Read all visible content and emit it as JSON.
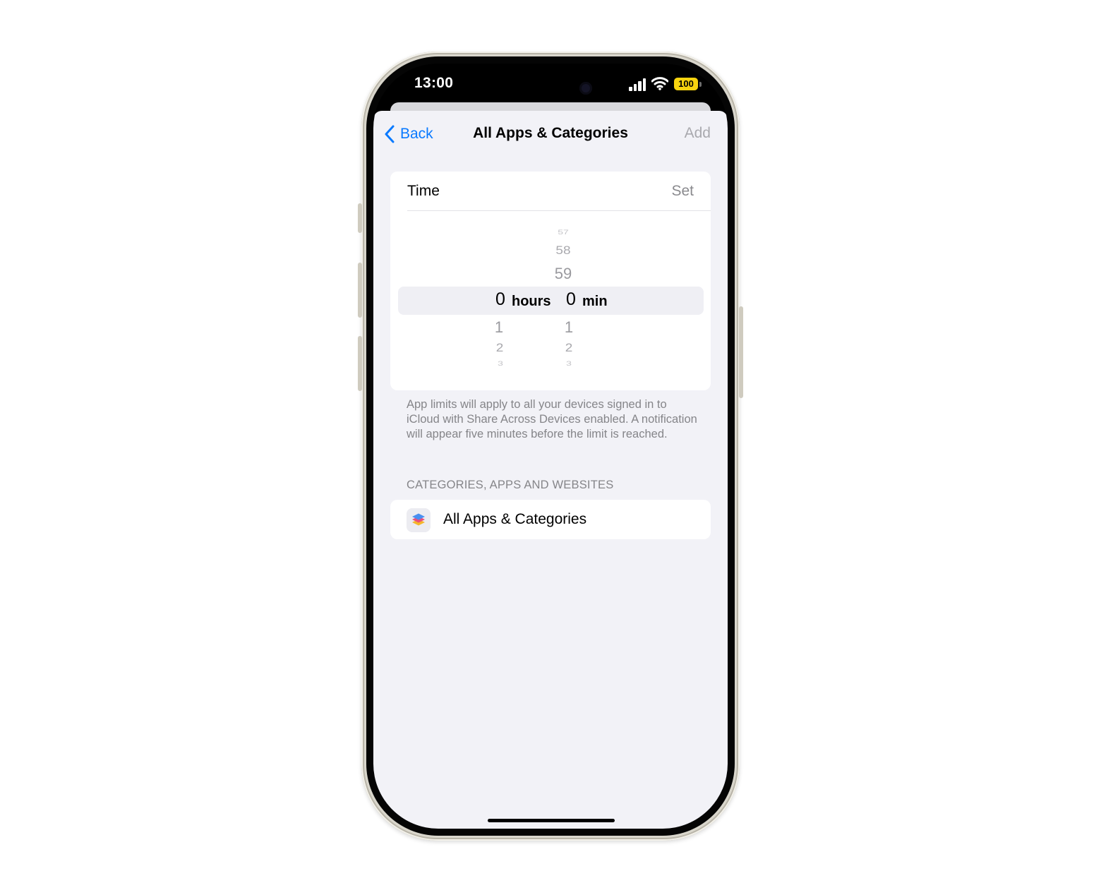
{
  "status_bar": {
    "time": "13:00",
    "battery": "100",
    "battery_color": "#f8d40f",
    "icons": [
      "signal-icon",
      "wifi-icon",
      "battery-icon"
    ]
  },
  "nav": {
    "back_label": "Back",
    "title": "All Apps & Categories",
    "add_label": "Add",
    "accent_color": "#0a7aff"
  },
  "time_section": {
    "label": "Time",
    "value": "Set"
  },
  "picker": {
    "hours": {
      "above": [],
      "selected": "0",
      "unit": "hours",
      "below": [
        "1",
        "2",
        "3"
      ]
    },
    "minutes": {
      "above": [
        "57",
        "58",
        "59"
      ],
      "selected": "0",
      "unit": "min",
      "below": [
        "1",
        "2",
        "3"
      ]
    }
  },
  "footer_note": "App limits will apply to all your devices signed in to iCloud with Share Across Devices enabled. A notification will appear five minutes before the limit is reached.",
  "section_header": "CATEGORIES, APPS AND WEBSITES",
  "apps_row": {
    "label": "All Apps & Categories",
    "icon": "stack-layers-icon"
  }
}
